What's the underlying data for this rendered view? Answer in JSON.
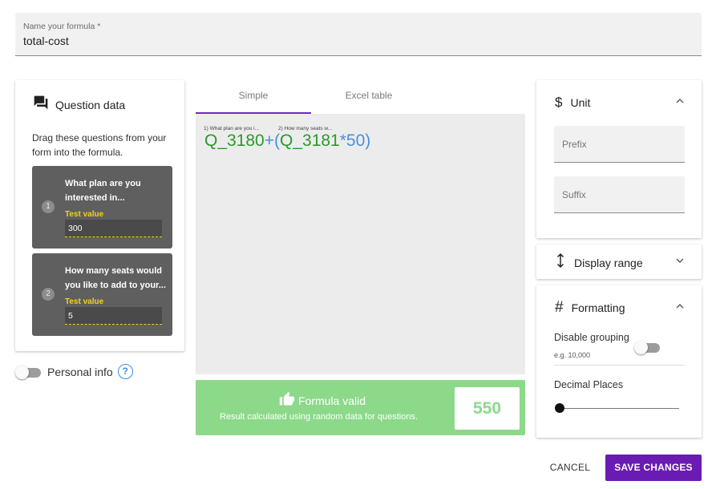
{
  "name_field": {
    "label": "Name your formula *",
    "value": "total-cost"
  },
  "question_panel": {
    "title": "Question data",
    "description": "Drag these questions from your form into the formula.",
    "questions": [
      {
        "number": "1",
        "text": "What plan are you interested in...",
        "test_value_label": "Test value",
        "test_value": "300"
      },
      {
        "number": "2",
        "text": "How many seats would you like to add to your...",
        "test_value_label": "Test value",
        "test_value": "5"
      }
    ]
  },
  "personal_info": {
    "label": "Personal info",
    "help": "?",
    "enabled": false
  },
  "tabs": [
    {
      "label": "Simple",
      "active": true
    },
    {
      "label": "Excel table",
      "active": false
    }
  ],
  "formula": {
    "chips": [
      {
        "label": "1) What plan are you i...",
        "token": "Q_3180"
      },
      {
        "label": "2) How many seats w...",
        "token": "Q_3181"
      }
    ],
    "op_plus": "+",
    "paren_open": "(",
    "op_times": "*",
    "constant": "50",
    "paren_close": ")"
  },
  "validation": {
    "title": "Formula valid",
    "subtitle": "Result calculated using random data for questions.",
    "result": "550",
    "color": "#8cd98a"
  },
  "unit_panel": {
    "title": "Unit",
    "icon": "dollar-icon",
    "prefix_placeholder": "Prefix",
    "suffix_placeholder": "Suffix",
    "chevron": "^"
  },
  "display_range_panel": {
    "title": "Display range",
    "icon": "vertical-arrows-icon",
    "chevron": "v"
  },
  "formatting_panel": {
    "title": "Formatting",
    "icon": "hash-icon",
    "chevron": "^",
    "disable_grouping_label": "Disable grouping",
    "grouping_example": "e.g. 10,000",
    "grouping_enabled": false,
    "decimal_places_label": "Decimal Places",
    "decimal_places": 0
  },
  "actions": {
    "cancel": "CANCEL",
    "save": "SAVE CHANGES"
  },
  "colors": {
    "accent": "#6a1bb3",
    "valid_green": "#8cd98a",
    "formula_green": "#2a9a2a",
    "formula_blue": "#4a8fe0",
    "test_value_yellow": "#f2d11c"
  }
}
